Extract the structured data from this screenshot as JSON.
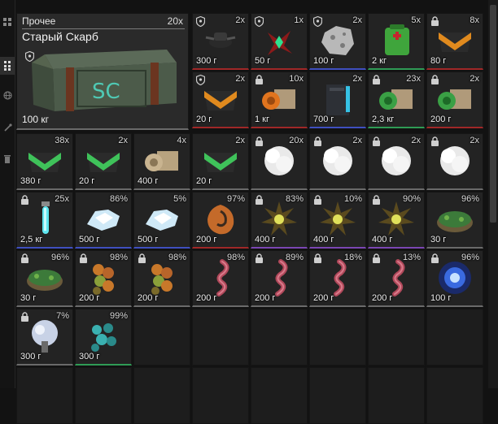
{
  "sidebar": {
    "icons": [
      "grid-icon",
      "list-icon",
      "globe-icon",
      "tools-icon",
      "trash-icon"
    ]
  },
  "featured_item": {
    "category": "Прочее",
    "name": "Старый Скарб",
    "crate_label": "SC",
    "quantity": "20x",
    "weight": "100 кг"
  },
  "top_items": [
    {
      "qty": "2x",
      "weight": "300 г",
      "icon": "drone-icon",
      "mark": "shield",
      "rarity": "r-red"
    },
    {
      "qty": "1x",
      "weight": "50 г",
      "icon": "crystal-cluster-icon",
      "mark": "shield",
      "rarity": "r-red"
    },
    {
      "qty": "2x",
      "weight": "100 г",
      "icon": "scrap-metal-icon",
      "mark": "shield",
      "rarity": "r-blue"
    },
    {
      "qty": "5x",
      "weight": "2 кг",
      "icon": "medkit-icon",
      "mark": "none",
      "rarity": "r-green"
    },
    {
      "qty": "8x",
      "weight": "80 г",
      "icon": "orange-case-icon",
      "mark": "lock",
      "rarity": "r-red"
    },
    {
      "qty": "2x",
      "weight": "20 г",
      "icon": "orange-case-icon",
      "mark": "shield",
      "rarity": "r-red"
    },
    {
      "qty": "10x",
      "weight": "1 кг",
      "icon": "orange-box-icon",
      "mark": "lock",
      "rarity": "r-red"
    },
    {
      "qty": "2x",
      "weight": "700 г",
      "icon": "blue-container-icon",
      "mark": "none",
      "rarity": "r-blue"
    },
    {
      "qty": "23x",
      "weight": "2,3 кг",
      "icon": "green-box-icon",
      "mark": "lock",
      "rarity": "r-green"
    },
    {
      "qty": "2x",
      "weight": "200 г",
      "icon": "green-box-icon",
      "mark": "lock",
      "rarity": "r-red"
    }
  ],
  "grid_items": [
    {
      "qty": "38x",
      "weight": "380 г",
      "icon": "green-case-icon",
      "mark": "none",
      "rarity": "r-gray"
    },
    {
      "qty": "2x",
      "weight": "20 г",
      "icon": "green-case-icon",
      "mark": "none",
      "rarity": "r-gray"
    },
    {
      "qty": "4x",
      "weight": "400 г",
      "icon": "beige-box-icon",
      "mark": "none",
      "rarity": "r-gray"
    },
    {
      "qty": "2x",
      "weight": "20 г",
      "icon": "green-case-icon",
      "mark": "none",
      "rarity": "r-gray"
    },
    {
      "qty": "20x",
      "weight": "",
      "icon": "white-cloud-icon",
      "mark": "lock",
      "rarity": "r-gray"
    },
    {
      "qty": "2x",
      "weight": "",
      "icon": "white-cloud-icon",
      "mark": "lock",
      "rarity": "r-gray"
    },
    {
      "qty": "2x",
      "weight": "",
      "icon": "white-cloud-icon",
      "mark": "lock",
      "rarity": "r-gray"
    },
    {
      "qty": "2x",
      "weight": "",
      "icon": "white-cloud-icon",
      "mark": "lock",
      "rarity": "r-gray"
    },
    {
      "qty": "25x",
      "weight": "2,5 кг",
      "icon": "glow-tube-icon",
      "mark": "lock",
      "rarity": "r-blue"
    },
    {
      "qty": "86%",
      "weight": "500 г",
      "icon": "ice-crystal-icon",
      "mark": "none",
      "rarity": "r-blue"
    },
    {
      "qty": "5%",
      "weight": "500 г",
      "icon": "ice-crystal-icon",
      "mark": "none",
      "rarity": "r-blue"
    },
    {
      "qty": "97%",
      "weight": "200 г",
      "icon": "orange-shell-icon",
      "mark": "none",
      "rarity": "r-red"
    },
    {
      "qty": "83%",
      "weight": "400 г",
      "icon": "spiky-artifact-icon",
      "mark": "lock",
      "rarity": "r-purple"
    },
    {
      "qty": "10%",
      "weight": "400 г",
      "icon": "spiky-artifact-icon",
      "mark": "lock",
      "rarity": "r-purple"
    },
    {
      "qty": "90%",
      "weight": "400 г",
      "icon": "spiky-artifact-icon",
      "mark": "lock",
      "rarity": "r-purple"
    },
    {
      "qty": "96%",
      "weight": "30 г",
      "icon": "moss-artifact-icon",
      "mark": "none",
      "rarity": "r-gray"
    },
    {
      "qty": "96%",
      "weight": "30 г",
      "icon": "moss-artifact-icon",
      "mark": "lock",
      "rarity": "r-gray"
    },
    {
      "qty": "98%",
      "weight": "200 г",
      "icon": "berry-cluster-icon",
      "mark": "lock",
      "rarity": "r-gray"
    },
    {
      "qty": "98%",
      "weight": "200 г",
      "icon": "berry-cluster-icon",
      "mark": "lock",
      "rarity": "r-gray"
    },
    {
      "qty": "98%",
      "weight": "200 г",
      "icon": "pink-tendril-icon",
      "mark": "none",
      "rarity": "r-gray"
    },
    {
      "qty": "89%",
      "weight": "200 г",
      "icon": "pink-tendril-icon",
      "mark": "lock",
      "rarity": "r-gray"
    },
    {
      "qty": "18%",
      "weight": "200 г",
      "icon": "pink-tendril-icon",
      "mark": "lock",
      "rarity": "r-gray"
    },
    {
      "qty": "13%",
      "weight": "200 г",
      "icon": "pink-tendril-icon",
      "mark": "lock",
      "rarity": "r-gray"
    },
    {
      "qty": "96%",
      "weight": "100 г",
      "icon": "electric-orb-icon",
      "mark": "lock",
      "rarity": "r-gray"
    },
    {
      "qty": "7%",
      "weight": "300 г",
      "icon": "silver-spore-icon",
      "mark": "lock",
      "rarity": "r-gray"
    },
    {
      "qty": "99%",
      "weight": "300 г",
      "icon": "teal-cluster-icon",
      "mark": "none",
      "rarity": "r-green"
    }
  ],
  "colors": {
    "rarity_red": "#a02828",
    "rarity_blue": "#3f4fbf",
    "rarity_green": "#2f9b55",
    "rarity_gray": "#6a6a6a",
    "rarity_purple": "#7b46b3",
    "cell_bg": "#232323"
  }
}
